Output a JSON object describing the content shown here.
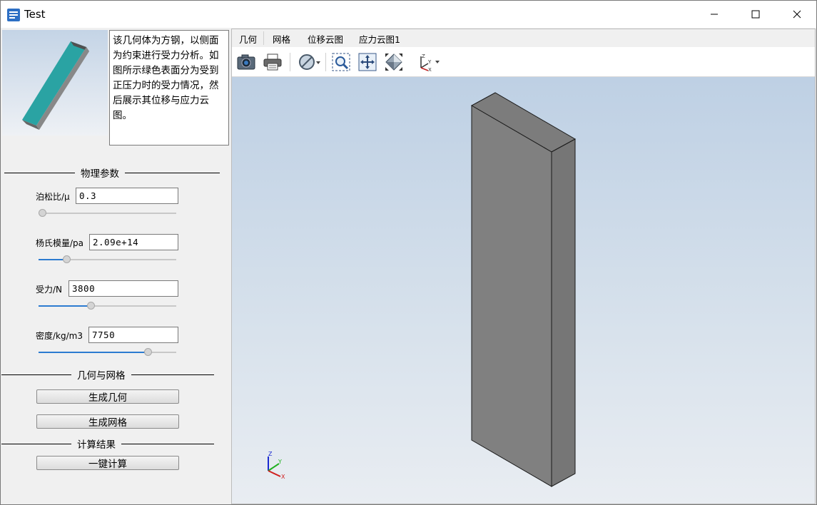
{
  "window": {
    "title": "Test"
  },
  "description": "该几何体为方钢，以侧面为约束进行受力分析。如图所示绿色表面分为受到正压力时的受力情况，然后展示其位移与应力云图。",
  "sections": {
    "physics": "物理参数",
    "geometry": "几何与网格",
    "results": "计算结果"
  },
  "params": {
    "poisson": {
      "label": "泊松比/μ",
      "value": "0.3",
      "slider": 0.0
    },
    "young": {
      "label": "杨氏模量/pa",
      "value": "2.09e+14",
      "slider": 0.2
    },
    "force": {
      "label": "受力/N",
      "value": "3800",
      "slider": 0.38
    },
    "density": {
      "label": "密度/kg/m3",
      "value": "7750",
      "slider": 0.78
    }
  },
  "buttons": {
    "gen_geometry": "生成几何",
    "gen_mesh": "生成网格",
    "compute": "一键计算"
  },
  "tabs": [
    "几何",
    "网格",
    "位移云图",
    "应力云图1"
  ],
  "axis_labels": {
    "x": "X",
    "y": "Y",
    "z": "Z"
  },
  "colors": {
    "model_face": "#808080",
    "highlight_face": "#2aa3a3"
  }
}
